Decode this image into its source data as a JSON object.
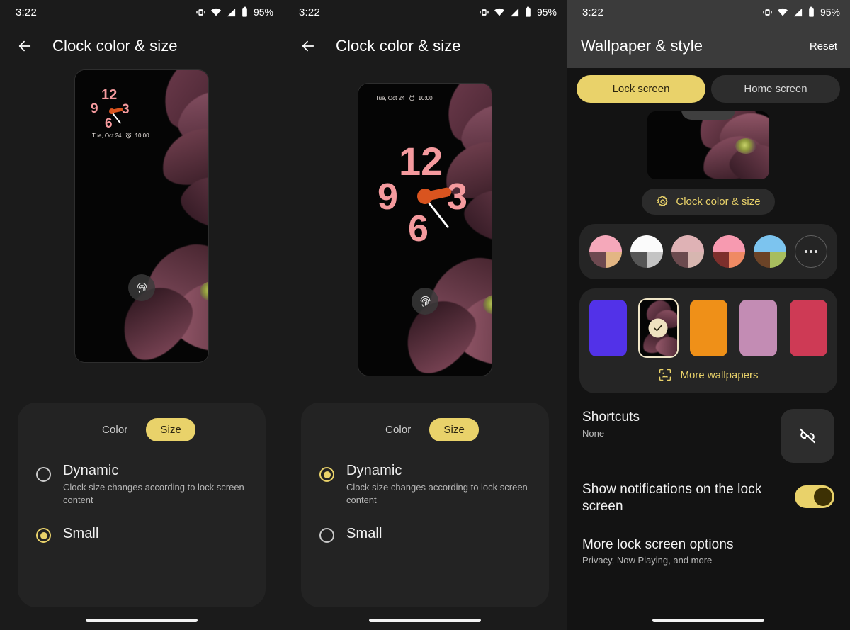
{
  "status_bar": {
    "time": "3:22",
    "battery_percent": "95%",
    "icons": [
      "vibrate-icon",
      "wifi-icon",
      "signal-icon",
      "battery-icon"
    ]
  },
  "panel_small": {
    "app_bar": {
      "back_icon": "back-arrow-icon",
      "title": "Clock color & size"
    },
    "preview": {
      "clock_style": "small",
      "date_text": "Tue, Oct 24",
      "alarm_icon": "alarm-icon",
      "alarm_time": "10:00",
      "clock_numerals": [
        "12",
        "3",
        "6",
        "9"
      ],
      "fingerprint_icon": "fingerprint-icon"
    },
    "segmented": {
      "options": [
        "Color",
        "Size"
      ],
      "selected": "Size"
    },
    "radio_options": [
      {
        "label": "Dynamic",
        "sub": "Clock size changes according to lock screen content",
        "selected": false
      },
      {
        "label": "Small",
        "sub": "",
        "selected": true
      }
    ]
  },
  "panel_dynamic": {
    "app_bar": {
      "back_icon": "back-arrow-icon",
      "title": "Clock color & size"
    },
    "preview": {
      "clock_style": "dynamic",
      "date_text": "Tue, Oct 24",
      "alarm_icon": "alarm-icon",
      "alarm_time": "10:00",
      "clock_numerals": [
        "12",
        "3",
        "6",
        "9"
      ],
      "fingerprint_icon": "fingerprint-icon"
    },
    "segmented": {
      "options": [
        "Color",
        "Size"
      ],
      "selected": "Size"
    },
    "radio_options": [
      {
        "label": "Dynamic",
        "sub": "Clock size changes according to lock screen content",
        "selected": true
      },
      {
        "label": "Small",
        "sub": "",
        "selected": false
      }
    ]
  },
  "panel_wallpaper": {
    "app_bar": {
      "title": "Wallpaper & style",
      "reset_label": "Reset"
    },
    "tabs": [
      {
        "label": "Lock screen",
        "active": true
      },
      {
        "label": "Home screen",
        "active": false
      }
    ],
    "clock_chip": {
      "icon": "gear-icon",
      "label": "Clock color & size"
    },
    "color_swatches": [
      {
        "name": "swatch-pink-tan",
        "top": "#f5a8ba",
        "bl": "#6d4950",
        "br": "#e3b684"
      },
      {
        "name": "swatch-white-gray",
        "top": "#fbfbfb",
        "bl": "#565656",
        "br": "#c4c4c4"
      },
      {
        "name": "swatch-mauve",
        "top": "#dfb2b5",
        "bl": "#6b4a4e",
        "br": "#d7b6b0"
      },
      {
        "name": "swatch-rose",
        "top": "#f79ab0",
        "bl": "#7d2f2c",
        "br": "#ef8a63"
      },
      {
        "name": "swatch-sky-olive",
        "top": "#7cc4ef",
        "bl": "#6b4327",
        "br": "#a7bd5e"
      }
    ],
    "more_colors_icon": "more-dots-icon",
    "wallpapers": [
      {
        "name": "wallpaper-indigo",
        "color": "#5232e8",
        "selected": false
      },
      {
        "name": "wallpaper-flower",
        "color": "#0b0608",
        "selected": true
      },
      {
        "name": "wallpaper-orange",
        "color": "#ef9018",
        "selected": false
      },
      {
        "name": "wallpaper-orchid",
        "color": "#c38cb4",
        "selected": false
      },
      {
        "name": "wallpaper-crimson",
        "color": "#ce3a55",
        "selected": false
      }
    ],
    "selected_check_icon": "check-icon",
    "more_wallpapers": {
      "icon": "image-frame-icon",
      "label": "More wallpapers"
    },
    "shortcuts": {
      "title": "Shortcuts",
      "sub": "None",
      "icon": "link-off-icon"
    },
    "notifications": {
      "title": "Show notifications on the lock screen",
      "toggle_on": true
    },
    "more_options": {
      "title": "More lock screen options",
      "sub": "Privacy, Now Playing, and more"
    }
  }
}
